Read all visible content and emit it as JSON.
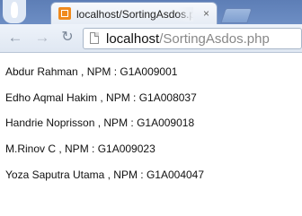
{
  "browser": {
    "tab": {
      "title": "localhost/SortingAsdos.php",
      "close_glyph": "×",
      "favicon": "xampp-favicon"
    },
    "nav": {
      "back_glyph": "←",
      "forward_glyph": "→",
      "reload_glyph": "↻"
    },
    "address": {
      "host": "localhost",
      "path": "/SortingAsdos.php"
    }
  },
  "students": [
    {
      "name": "Abdur Rahman",
      "separator": " , NPM : ",
      "npm": "G1A009001"
    },
    {
      "name": "Edho Aqmal Hakim",
      "separator": " , NPM : ",
      "npm": "G1A008037"
    },
    {
      "name": "Handrie Noprisson",
      "separator": " , NPM : ",
      "npm": "G1A009018"
    },
    {
      "name": "M.Rinov C",
      "separator": " , NPM : ",
      "npm": "G1A009023"
    },
    {
      "name": "Yoza Saputra Utama",
      "separator": " , NPM : ",
      "npm": "G1A004047"
    }
  ],
  "colors": {
    "tabstrip": "#6d8ec4",
    "toolbar": "#e6edf7",
    "favicon": "#f08a1d",
    "text": "#111111"
  }
}
